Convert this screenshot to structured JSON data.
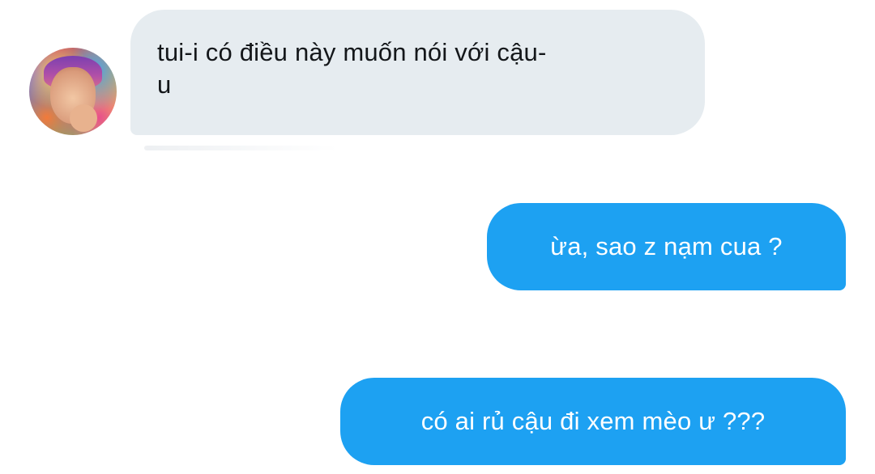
{
  "conversation": {
    "messages": [
      {
        "sender": "them",
        "text": "tui-i có điều này muốn nói với cậu-\nu"
      },
      {
        "sender": "me",
        "text": "ừa, sao z nạm cua ?"
      },
      {
        "sender": "me",
        "text": "có ai rủ cậu đi xem mèo ư ???"
      }
    ]
  },
  "colors": {
    "incoming_bubble": "#e6ecf0",
    "outgoing_bubble": "#1da1f2",
    "incoming_text": "#14171a",
    "outgoing_text": "#ffffff"
  }
}
